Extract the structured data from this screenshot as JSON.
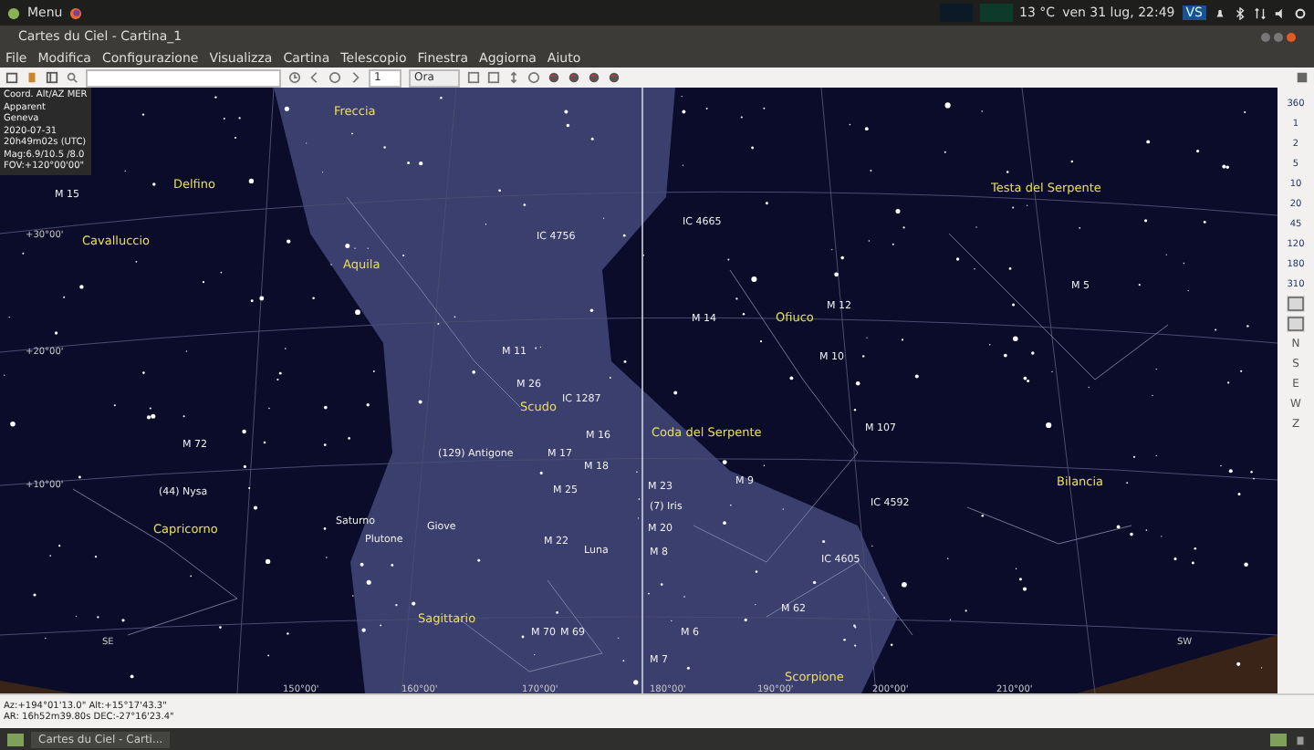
{
  "top_panel": {
    "menu_label": "Menu",
    "temperature": "13 °C",
    "clock": "ven 31 lug, 22:49",
    "badge": "VS"
  },
  "window": {
    "title": "Cartes du Ciel - Cartina_1"
  },
  "menu_bar": [
    "File",
    "Modifica",
    "Configurazione",
    "Visualizza",
    "Cartina",
    "Telescopio",
    "Finestra",
    "Aggiorna",
    "Aiuto"
  ],
  "toolbar": {
    "step": "1",
    "step_unit": "Ora"
  },
  "chart": {
    "info_lines": [
      "Coord. Alt/AZ MER",
      "Apparent",
      "Geneva",
      "2020-07-31",
      "20h49m02s (UTC)",
      "Mag:6.9/10.5 /8.0",
      "FOV:+120°00'00\""
    ],
    "constellations": [
      "Freccia",
      "Delfino",
      "Cavalluccio",
      "Aquila",
      "Scudo",
      "Coda del Serpente",
      "Ofiuco",
      "Testa del Serpente",
      "Capricorno",
      "Sagittario",
      "Bilancia",
      "Scorpione"
    ],
    "objects": [
      "M 15",
      "IC 4756",
      "IC 4665",
      "M 11",
      "M 26",
      "IC 1287",
      "M 16",
      "M 17",
      "M 18",
      "M 25",
      "M 23",
      "(7) Iris",
      "M 9",
      "M 14",
      "M 12",
      "M 10",
      "M 107",
      "M 5",
      "M 72",
      "(44) Nysa",
      "(129) Antigone",
      "Saturno",
      "Plutone",
      "Giove",
      "M 22",
      "Luna",
      "M 20",
      "M 8",
      "IC 4592",
      "IC 4605",
      "M 62",
      "M 70",
      "M 69",
      "M 7",
      "M 6"
    ],
    "grid_labels": [
      "+30°00'",
      "+20°00'",
      "+10°00'",
      "SE",
      "150°00'",
      "160°00'",
      "170°00'",
      "180°00'",
      "190°00'",
      "200°00'",
      "210°00'",
      "SW"
    ]
  },
  "fov_buttons": [
    "360",
    "1",
    "2",
    "5",
    "10",
    "20",
    "45",
    "120",
    "180",
    "310"
  ],
  "direction_buttons": [
    "N",
    "S",
    "E",
    "W",
    "Z"
  ],
  "status_bar": {
    "lines": [
      "Az:+194°01'13.0\" Alt:+15°17'43.3\"",
      "AR: 16h52m39.80s DEC:-27°16'23.4\""
    ]
  },
  "taskbar": {
    "window_button": "Cartes du Ciel - Carti..."
  }
}
